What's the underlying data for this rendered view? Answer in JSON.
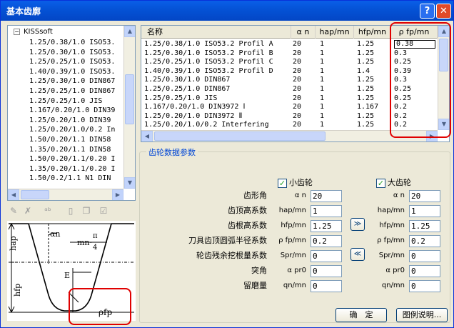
{
  "window": {
    "title": "基本齿廓",
    "help": "?",
    "close": "✕"
  },
  "tree": {
    "root": "KISSsoft",
    "expander": "−",
    "items": [
      "1.25/0.38/1.0 ISO53.",
      "1.25/0.30/1.0 ISO53.",
      "1.25/0.25/1.0 ISO53.",
      "1.40/0.39/1.0 ISO53.",
      "1.25/0.30/1.0 DIN867",
      "1.25/0.25/1.0 DIN867",
      "1.25/0.25/1.0 JIS",
      "1.167/0.20/1.0 DIN39",
      "1.25/0.20/1.0 DIN39",
      "1.25/0.20/1.0/0.2 In",
      "1.50/0.20/1.1 DIN58",
      "1.35/0.20/1.1 DIN58",
      "1.50/0.20/1.1/0.20 I",
      "1.35/0.20/1.1/0.20 I",
      "1.50/0.2/1.1 N1 DIN"
    ]
  },
  "grid": {
    "headers": [
      "名称",
      "α n",
      "hap/mn",
      "hfp/mn",
      "ρ fp/mn"
    ],
    "rows": [
      [
        "1.25/0.38/1.0 ISO53.2 Profil A",
        "20",
        "1",
        "1.25",
        "0.38"
      ],
      [
        "1.25/0.30/1.0 ISO53.2 Profil B",
        "20",
        "1",
        "1.25",
        "0.3"
      ],
      [
        "1.25/0.25/1.0 ISO53.2 Profil C",
        "20",
        "1",
        "1.25",
        "0.25"
      ],
      [
        "1.40/0.39/1.0 ISO53.2 Profil D",
        "20",
        "1",
        "1.4",
        "0.39"
      ],
      [
        "1.25/0.30/1.0 DIN867",
        "20",
        "1",
        "1.25",
        "0.3"
      ],
      [
        "1.25/0.25/1.0 DIN867",
        "20",
        "1",
        "1.25",
        "0.25"
      ],
      [
        "1.25/0.25/1.0 JIS",
        "20",
        "1",
        "1.25",
        "0.25"
      ],
      [
        "1.167/0.20/1.0 DIN3972 Ⅰ",
        "20",
        "1",
        "1.167",
        "0.2"
      ],
      [
        "1.25/0.20/1.0 DIN3972 Ⅱ",
        "20",
        "1",
        "1.25",
        "0.2"
      ],
      [
        "1.25/0.20/1.0/0.2 Interfering",
        "20",
        "1",
        "1.25",
        "0.2"
      ]
    ]
  },
  "group": {
    "title": "齿轮数据参数",
    "pinion": "小齿轮",
    "gear": "大齿轮",
    "check": "✓",
    "copy_right": "≫",
    "copy_left": "≪",
    "params": [
      {
        "label": "齿形角",
        "sym": "α n",
        "pinion": "20",
        "gear": "20"
      },
      {
        "label": "齿顶高系数",
        "sym": "hap/mn",
        "pinion": "1",
        "gear": "1"
      },
      {
        "label": "齿根高系数",
        "sym": "hfp/mn",
        "pinion": "1.25",
        "gear": "1.25"
      },
      {
        "label": "刀具齿顶圆弧半径系数",
        "sym": "ρ fp/mn",
        "pinion": "0.2",
        "gear": "0.2"
      },
      {
        "label": "轮齿残余挖根量系数",
        "sym": "Spr/mn",
        "pinion": "0",
        "gear": "0"
      },
      {
        "label": "突角",
        "sym": "α pr0",
        "pinion": "0",
        "gear": "0"
      },
      {
        "label": "留磨量",
        "sym": "qn/mn",
        "pinion": "0",
        "gear": "0"
      }
    ]
  },
  "buttons": {
    "ok": "确　定",
    "legend": "图例说明..."
  },
  "diagram": {
    "hap": "hap",
    "hfp": "hfp",
    "alpha": "αn",
    "m": "mn·",
    "pi": "π",
    "four": "4",
    "e": "E",
    "rho": "ρfp"
  },
  "colors": {
    "highlight": "#e00000",
    "title_bar": "#0553d7",
    "selection": "#316ac5"
  }
}
